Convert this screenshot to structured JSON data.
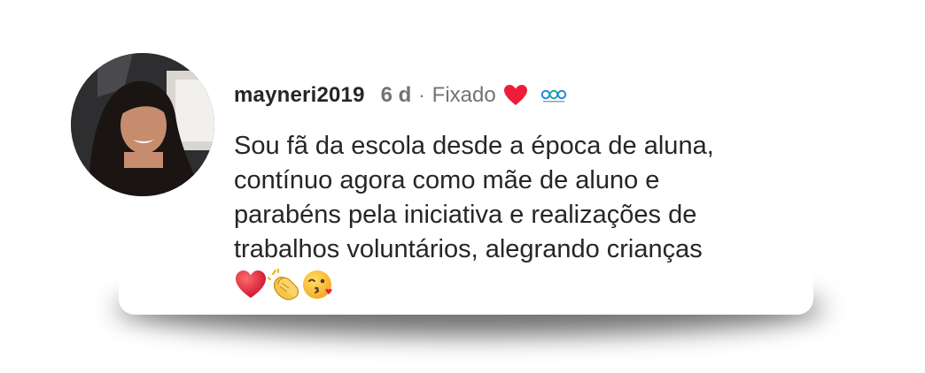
{
  "comment": {
    "username": "mayneri2019",
    "time": "6 d",
    "separator": "·",
    "pinned_label": "Fixado",
    "text_lines": [
      "Sou fã da escola desde a época de aluna,",
      "contínuo agora como mãe de aluno e",
      "parabéns pela iniciativa e realizações de",
      "trabalhos voluntários, alegrando crianças"
    ],
    "emojis": [
      "red-heart-emoji",
      "clapping-hands-emoji",
      "kissing-face-emoji"
    ],
    "brand_logo_text": "cea"
  },
  "colors": {
    "text": "#262626",
    "meta": "#737373",
    "heart": "#ed1c39",
    "logo": "#1e88e5"
  }
}
